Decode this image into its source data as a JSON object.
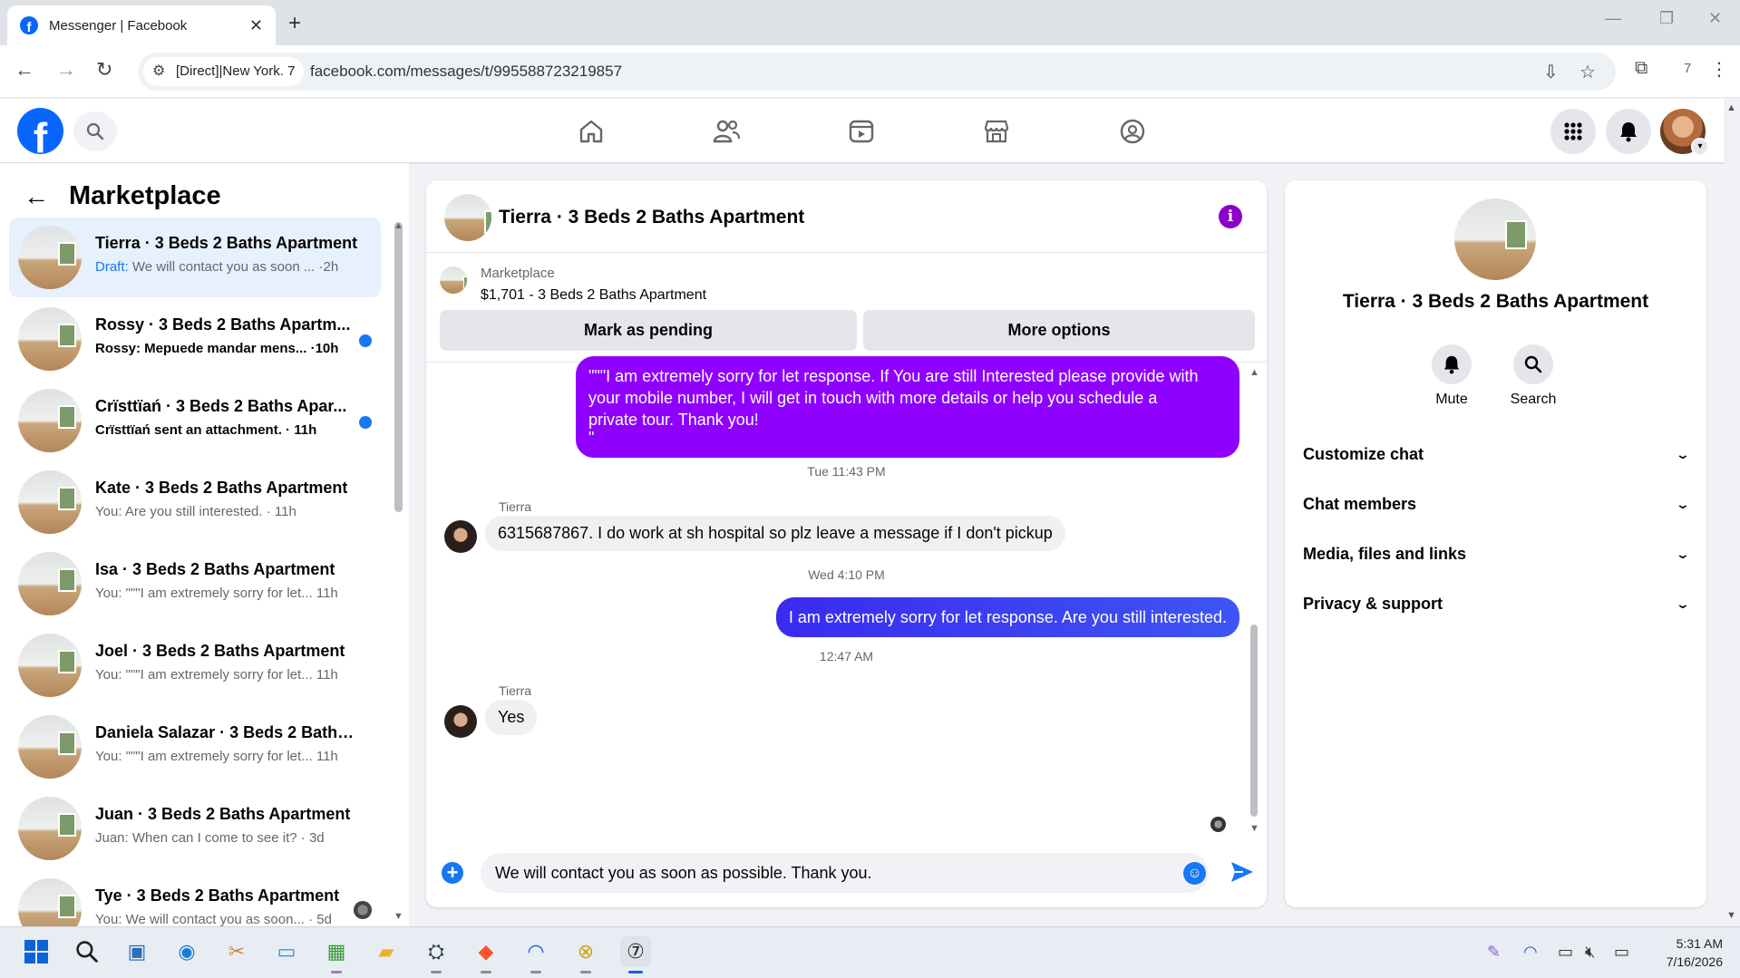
{
  "browser": {
    "tab_title": "Messenger | Facebook",
    "site_chip": "[Direct]|New York. 7",
    "url": "facebook.com/messages/t/995588723219857",
    "profile_count": "7"
  },
  "sidebar": {
    "title": "Marketplace",
    "conversations": [
      {
        "name": "Tierra · 3 Beds 2 Baths Apartment",
        "draft_label": "Draft:",
        "preview": " We will contact you as soon ...",
        "time": " ·2h",
        "unread": false,
        "active": true
      },
      {
        "name": "Rossy · 3 Beds 2 Baths Apartm...",
        "preview": "Rossy: Mepuede mandar mens...",
        "time": " ·10h",
        "unread": true
      },
      {
        "name": "Crïsttïań · 3 Beds 2 Baths Apar...",
        "preview": "Crïsttïań sent an attachment.",
        "time": " · 11h",
        "unread": true
      },
      {
        "name": "Kate · 3 Beds 2 Baths Apartment",
        "preview": "You: Are you still interested.",
        "time": " · 11h",
        "unread": false
      },
      {
        "name": "Isa · 3 Beds 2 Baths Apartment",
        "preview": "You: \"\"\"I am extremely sorry for let...",
        "time": " 11h",
        "unread": false
      },
      {
        "name": "Joel · 3 Beds 2 Baths Apartment",
        "preview": "You: \"\"\"I am extremely sorry for let...",
        "time": " 11h",
        "unread": false
      },
      {
        "name": "Daniela Salazar · 3 Beds 2 Baths ...",
        "preview": "You: \"\"\"I am extremely sorry for let...",
        "time": " 11h",
        "unread": false
      },
      {
        "name": "Juan · 3 Beds 2 Baths Apartment",
        "preview": "Juan: When can I come to see it?",
        "time": " · 3d",
        "unread": false
      },
      {
        "name": "Tye · 3 Beds 2 Baths Apartment",
        "preview": "You: We will contact you as soon...",
        "time": " · 5d",
        "unread": false
      }
    ]
  },
  "chat": {
    "title": "Tierra · 3 Beds 2 Baths Apartment",
    "marketplace_label": "Marketplace",
    "listing": "$1,701 - 3 Beds 2 Baths Apartment",
    "mark_pending": "Mark as pending",
    "more_options": "More options",
    "messages": {
      "out1_line1": "\"\"\"I am extremely sorry for let response. If You are still Interested please provide with",
      "out1_line2": "your mobile number, I will get in touch with more details or help you schedule a",
      "out1_line3": "private tour. Thank you!",
      "out1_line4": "\"",
      "ts1": "Tue 11:43 PM",
      "sender1": "Tierra",
      "in1": "6315687867. I do work at sh hospital so plz leave a message if I don't pickup",
      "ts2": "Wed 4:10 PM",
      "out2": "I am extremely sorry for let response. Are you still interested.",
      "ts3": "12:47 AM",
      "sender2": "Tierra",
      "in2": "Yes"
    },
    "composer_value": "We will contact you as soon as possible. Thank you."
  },
  "info_panel": {
    "name": "Tierra · 3 Beds 2 Baths Apartment",
    "mute_label": "Mute",
    "search_label": "Search",
    "sections": [
      "Customize chat",
      "Chat members",
      "Media, files and links",
      "Privacy & support"
    ]
  },
  "taskbar": {
    "time": "5:31 AM",
    "date": "7/16/2026"
  },
  "colors": {
    "fb_blue": "#0866ff",
    "outgoing_purple": "#8f00ff",
    "outgoing_blue": "#3a2bf0",
    "active_row": "#e7f0fd",
    "unread_dot": "#1877f2"
  }
}
